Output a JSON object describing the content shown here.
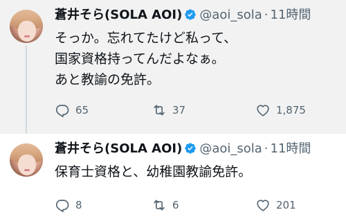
{
  "tweets": [
    {
      "display_name": "蒼井そら(SOLA AOI)",
      "handle": "@aoi_sola",
      "separator": "·",
      "time": "11時間",
      "text": "そっか。忘れてたけど私って、\n国家資格持ってんだよなぁ。\nあと教諭の免許。",
      "replies": "65",
      "retweets": "37",
      "likes": "1,875"
    },
    {
      "display_name": "蒼井そら(SOLA AOI)",
      "handle": "@aoi_sola",
      "separator": "·",
      "time": "11時間",
      "text": "保育士資格と、幼稚園教諭免許。",
      "replies": "8",
      "retweets": "6",
      "likes": "201"
    }
  ],
  "colors": {
    "verified_badge": "#1d9bf0",
    "secondary_text": "#536471",
    "thread_line": "#cfd9de",
    "highlight_bg": "#f2f2f2"
  },
  "icons": [
    "verified-badge-icon",
    "reply-icon",
    "retweet-icon",
    "like-icon"
  ]
}
